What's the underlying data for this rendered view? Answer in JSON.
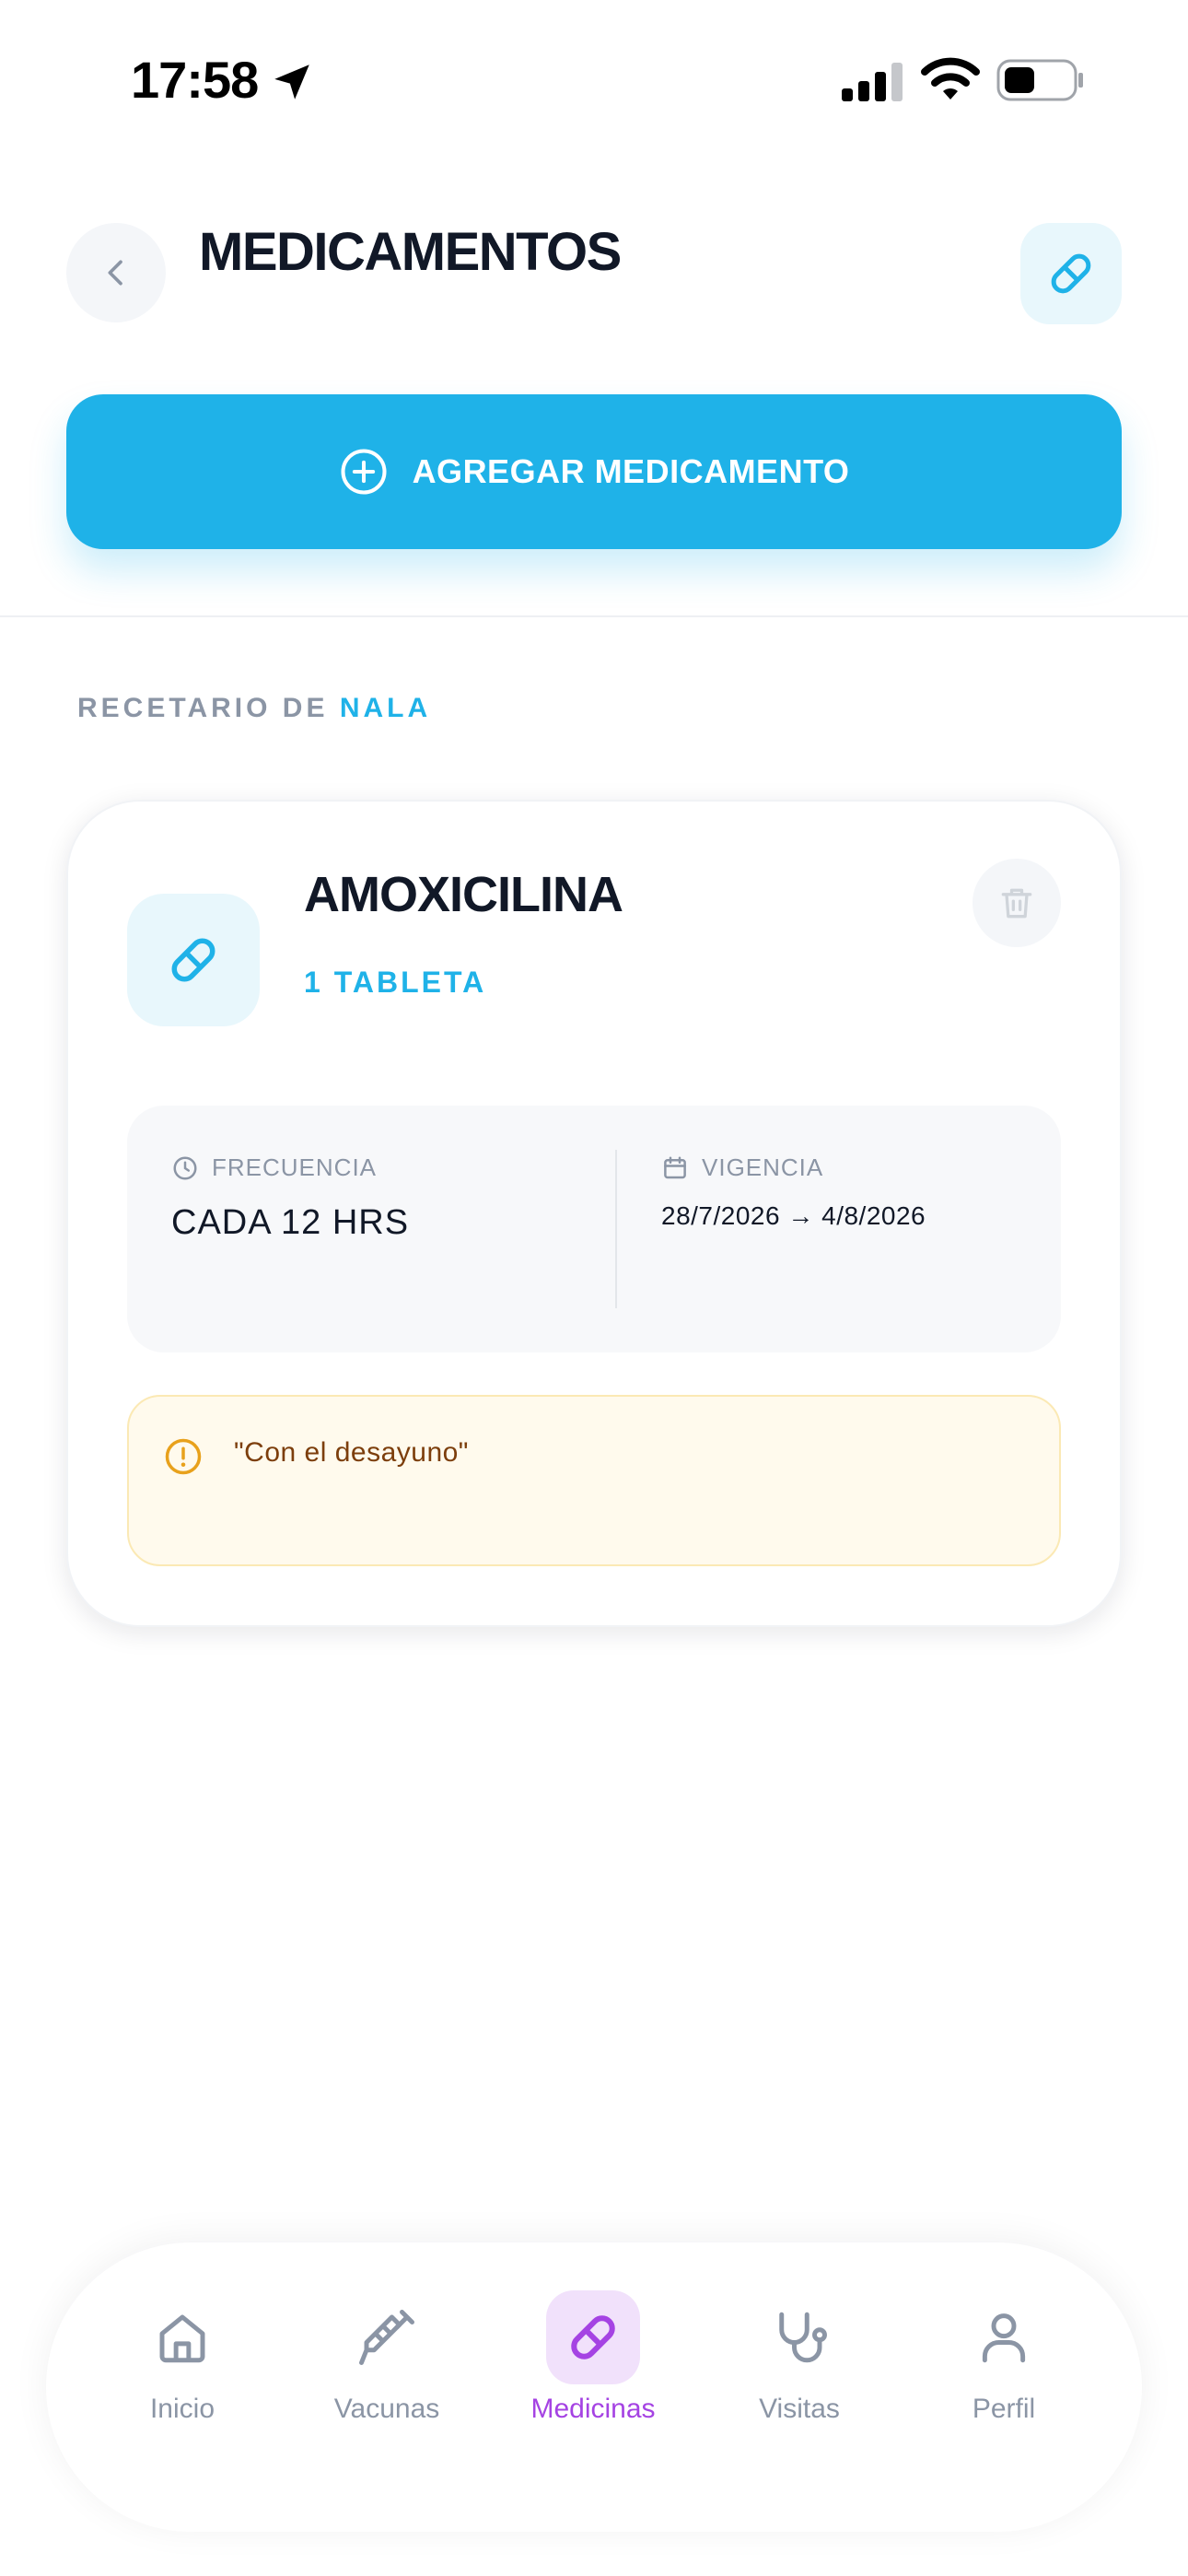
{
  "status_bar": {
    "time": "17:58"
  },
  "header": {
    "title": "MEDICAMENTOS"
  },
  "add_button": {
    "label": "AGREGAR MEDICAMENTO"
  },
  "section": {
    "prefix": "RECETARIO DE",
    "pet_name": "NALA"
  },
  "medication": {
    "name": "AMOXICILINA",
    "dose": "1 TABLETA",
    "frequency_label": "FRECUENCIA",
    "frequency_value": "CADA 12 HRS",
    "validity_label": "VIGENCIA",
    "validity_value": "28/7/2026 → 4/8/2026",
    "note": "\"Con el desayuno\""
  },
  "nav": {
    "items": [
      {
        "label": "Inicio",
        "icon": "home-icon"
      },
      {
        "label": "Vacunas",
        "icon": "syringe-icon"
      },
      {
        "label": "Medicinas",
        "icon": "pill-icon",
        "active": true
      },
      {
        "label": "Visitas",
        "icon": "stethoscope-icon"
      },
      {
        "label": "Perfil",
        "icon": "user-icon"
      }
    ]
  },
  "colors": {
    "accent": "#1fb2e8",
    "active_tab": "#a543e3",
    "note_text": "#7c3e0c"
  }
}
